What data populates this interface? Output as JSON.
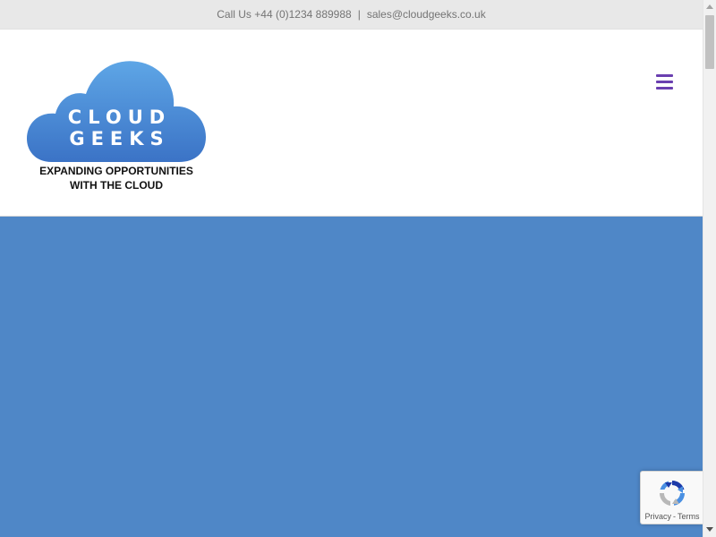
{
  "topbar": {
    "call_text": "Call Us +44 (0)1234 889988",
    "separator": "|",
    "email": "sales@cloudgeeks.co.uk"
  },
  "logo": {
    "word1": "CLOUD",
    "word2": "GEEKS",
    "tagline_line1": "EXPANDING OPPORTUNITIES",
    "tagline_line2": "WITH THE CLOUD",
    "cloud_color_top": "#5ea6e6",
    "cloud_color_bottom": "#3b73c6"
  },
  "header": {
    "menu_icon": "hamburger-menu-icon",
    "menu_icon_color": "#6a3fb0"
  },
  "hero": {
    "background_color": "#4f87c7"
  },
  "recaptcha": {
    "icon": "recaptcha-logo-icon",
    "privacy_label": "Privacy",
    "separator": "-",
    "terms_label": "Terms"
  }
}
